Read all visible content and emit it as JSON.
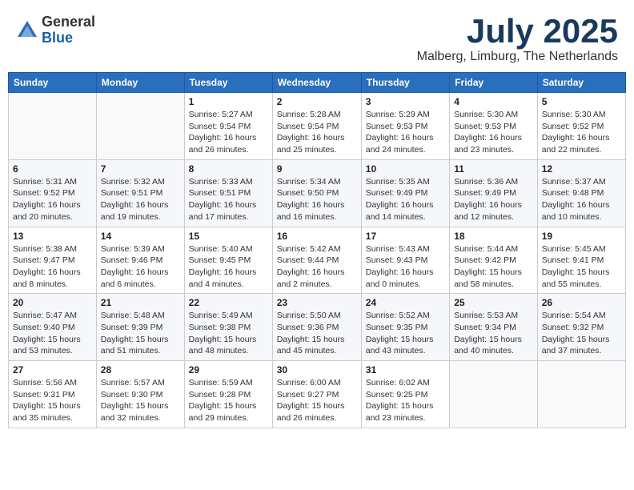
{
  "header": {
    "logo_general": "General",
    "logo_blue": "Blue",
    "month_title": "July 2025",
    "location": "Malberg, Limburg, The Netherlands"
  },
  "weekdays": [
    "Sunday",
    "Monday",
    "Tuesday",
    "Wednesday",
    "Thursday",
    "Friday",
    "Saturday"
  ],
  "weeks": [
    [
      {
        "day": "",
        "info": ""
      },
      {
        "day": "",
        "info": ""
      },
      {
        "day": "1",
        "info": "Sunrise: 5:27 AM\nSunset: 9:54 PM\nDaylight: 16 hours and 26 minutes."
      },
      {
        "day": "2",
        "info": "Sunrise: 5:28 AM\nSunset: 9:54 PM\nDaylight: 16 hours and 25 minutes."
      },
      {
        "day": "3",
        "info": "Sunrise: 5:29 AM\nSunset: 9:53 PM\nDaylight: 16 hours and 24 minutes."
      },
      {
        "day": "4",
        "info": "Sunrise: 5:30 AM\nSunset: 9:53 PM\nDaylight: 16 hours and 23 minutes."
      },
      {
        "day": "5",
        "info": "Sunrise: 5:30 AM\nSunset: 9:52 PM\nDaylight: 16 hours and 22 minutes."
      }
    ],
    [
      {
        "day": "6",
        "info": "Sunrise: 5:31 AM\nSunset: 9:52 PM\nDaylight: 16 hours and 20 minutes."
      },
      {
        "day": "7",
        "info": "Sunrise: 5:32 AM\nSunset: 9:51 PM\nDaylight: 16 hours and 19 minutes."
      },
      {
        "day": "8",
        "info": "Sunrise: 5:33 AM\nSunset: 9:51 PM\nDaylight: 16 hours and 17 minutes."
      },
      {
        "day": "9",
        "info": "Sunrise: 5:34 AM\nSunset: 9:50 PM\nDaylight: 16 hours and 16 minutes."
      },
      {
        "day": "10",
        "info": "Sunrise: 5:35 AM\nSunset: 9:49 PM\nDaylight: 16 hours and 14 minutes."
      },
      {
        "day": "11",
        "info": "Sunrise: 5:36 AM\nSunset: 9:49 PM\nDaylight: 16 hours and 12 minutes."
      },
      {
        "day": "12",
        "info": "Sunrise: 5:37 AM\nSunset: 9:48 PM\nDaylight: 16 hours and 10 minutes."
      }
    ],
    [
      {
        "day": "13",
        "info": "Sunrise: 5:38 AM\nSunset: 9:47 PM\nDaylight: 16 hours and 8 minutes."
      },
      {
        "day": "14",
        "info": "Sunrise: 5:39 AM\nSunset: 9:46 PM\nDaylight: 16 hours and 6 minutes."
      },
      {
        "day": "15",
        "info": "Sunrise: 5:40 AM\nSunset: 9:45 PM\nDaylight: 16 hours and 4 minutes."
      },
      {
        "day": "16",
        "info": "Sunrise: 5:42 AM\nSunset: 9:44 PM\nDaylight: 16 hours and 2 minutes."
      },
      {
        "day": "17",
        "info": "Sunrise: 5:43 AM\nSunset: 9:43 PM\nDaylight: 16 hours and 0 minutes."
      },
      {
        "day": "18",
        "info": "Sunrise: 5:44 AM\nSunset: 9:42 PM\nDaylight: 15 hours and 58 minutes."
      },
      {
        "day": "19",
        "info": "Sunrise: 5:45 AM\nSunset: 9:41 PM\nDaylight: 15 hours and 55 minutes."
      }
    ],
    [
      {
        "day": "20",
        "info": "Sunrise: 5:47 AM\nSunset: 9:40 PM\nDaylight: 15 hours and 53 minutes."
      },
      {
        "day": "21",
        "info": "Sunrise: 5:48 AM\nSunset: 9:39 PM\nDaylight: 15 hours and 51 minutes."
      },
      {
        "day": "22",
        "info": "Sunrise: 5:49 AM\nSunset: 9:38 PM\nDaylight: 15 hours and 48 minutes."
      },
      {
        "day": "23",
        "info": "Sunrise: 5:50 AM\nSunset: 9:36 PM\nDaylight: 15 hours and 45 minutes."
      },
      {
        "day": "24",
        "info": "Sunrise: 5:52 AM\nSunset: 9:35 PM\nDaylight: 15 hours and 43 minutes."
      },
      {
        "day": "25",
        "info": "Sunrise: 5:53 AM\nSunset: 9:34 PM\nDaylight: 15 hours and 40 minutes."
      },
      {
        "day": "26",
        "info": "Sunrise: 5:54 AM\nSunset: 9:32 PM\nDaylight: 15 hours and 37 minutes."
      }
    ],
    [
      {
        "day": "27",
        "info": "Sunrise: 5:56 AM\nSunset: 9:31 PM\nDaylight: 15 hours and 35 minutes."
      },
      {
        "day": "28",
        "info": "Sunrise: 5:57 AM\nSunset: 9:30 PM\nDaylight: 15 hours and 32 minutes."
      },
      {
        "day": "29",
        "info": "Sunrise: 5:59 AM\nSunset: 9:28 PM\nDaylight: 15 hours and 29 minutes."
      },
      {
        "day": "30",
        "info": "Sunrise: 6:00 AM\nSunset: 9:27 PM\nDaylight: 15 hours and 26 minutes."
      },
      {
        "day": "31",
        "info": "Sunrise: 6:02 AM\nSunset: 9:25 PM\nDaylight: 15 hours and 23 minutes."
      },
      {
        "day": "",
        "info": ""
      },
      {
        "day": "",
        "info": ""
      }
    ]
  ]
}
